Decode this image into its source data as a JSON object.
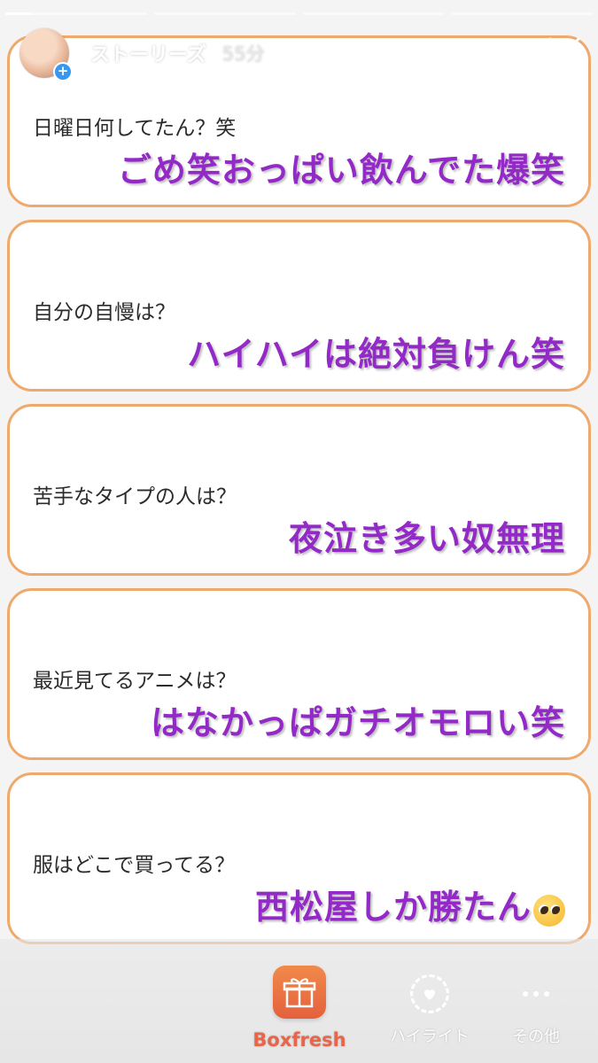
{
  "story": {
    "progress": [
      1.0,
      0.0,
      0.0,
      0.0
    ],
    "username": "ストーリーズ",
    "time": "55分"
  },
  "cards": [
    {
      "question": "日曜日何してたん？笑",
      "answer": "ごめ笑おっぱい飲んでた爆笑"
    },
    {
      "question": "自分の自慢は？",
      "answer": "ハイハイは絶対負けん笑"
    },
    {
      "question": "苦手なタイプの人は？",
      "answer": "夜泣き多い奴無理"
    },
    {
      "question": "最近見てるアニメは？",
      "answer": "はなかっぱガチオモロい笑"
    },
    {
      "question": "服はどこで買ってる？",
      "answer": "西松屋しか勝たん",
      "emoji": "pleading-face-emoji"
    }
  ],
  "bottom": {
    "brand_label": "Boxfresh",
    "highlight_label": "ハイライト",
    "more_label": "その他"
  },
  "colors": {
    "card_border": "#efa96b",
    "answer_text": "#9329c7",
    "brand": "#e8654a"
  }
}
